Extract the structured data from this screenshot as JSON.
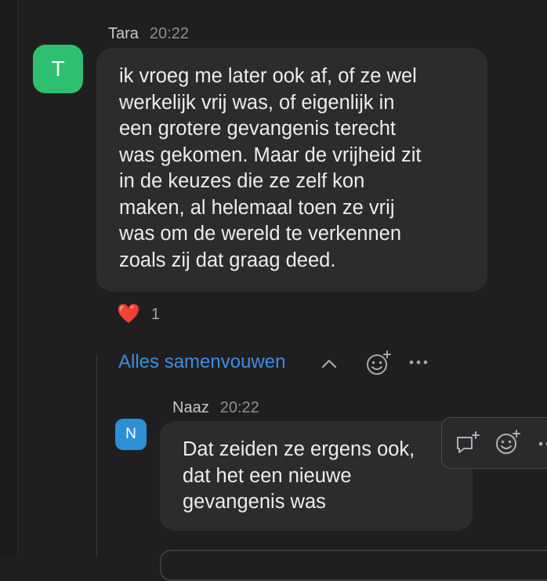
{
  "messages": [
    {
      "author": "Tara",
      "time": "20:22",
      "avatar_letter": "T",
      "avatar_color": "#2fbf71",
      "lines": [
        "ik vroeg me later ook af, of ze wel",
        "werkelijk vrij was, of eigenlijk in",
        "een grotere gevangenis terecht",
        "was gekomen. Maar de vrijheid zit",
        "in de keuzes die ze zelf kon",
        "maken, al helemaal toen ze vrij",
        "was om de wereld te verkennen",
        "zoals zij dat graag deed."
      ],
      "reactions": [
        {
          "emoji": "❤️",
          "icon": "heart-icon",
          "count": "1"
        }
      ]
    }
  ],
  "thread": {
    "collapse_label": "Alles samenvouwen",
    "collapse_icon": "chevron-up-icon",
    "actions": [
      "add-reaction-icon",
      "more-icon"
    ],
    "replies": [
      {
        "author": "Naaz",
        "time": "20:22",
        "avatar_letter": "N",
        "avatar_color": "#2d8fd6",
        "lines": [
          "Dat zeiden ze ergens ook,",
          "dat het een nieuwe",
          "gevangenis was"
        ],
        "hover_actions": [
          "reply-icon",
          "add-reaction-icon",
          "more-icon"
        ]
      }
    ]
  },
  "colors": {
    "background": "#1f1f20",
    "bubble": "#2c2c2e",
    "link": "#3e8ee0",
    "heart": "#e5463b"
  }
}
